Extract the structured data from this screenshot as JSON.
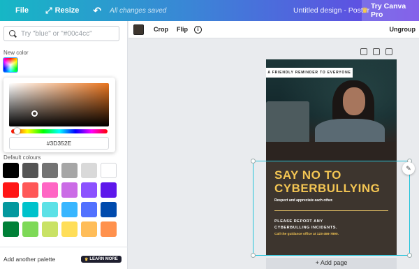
{
  "topbar": {
    "file_label": "File",
    "resize_label": "Resize",
    "undo_icon": "undo-icon",
    "saved_status": "All changes saved",
    "design_title": "Untitled design - Poster",
    "pro_label": "Try Canva Pro",
    "gradient_colors": [
      "#16b7c5",
      "#3a86d6",
      "#6a3fe6"
    ]
  },
  "color_panel": {
    "search_placeholder": "Try \"blue\" or \"#00c4cc\"",
    "new_color_label": "New color",
    "picker": {
      "hex_value": "#3D352E"
    },
    "default_colours_label": "Default colours",
    "default_swatches": [
      "#000000",
      "#545454",
      "#737373",
      "#a6a6a6",
      "#d9d9d9",
      "#ffffff",
      "#ff1616",
      "#ff5757",
      "#ff66c4",
      "#cb6ce6",
      "#8c52ff",
      "#5e17eb",
      "#03989e",
      "#00c2cb",
      "#5ce1e6",
      "#38b6ff",
      "#5271ff",
      "#004aad",
      "#008037",
      "#7ed957",
      "#c9e265",
      "#ffde59",
      "#ffbd59",
      "#ff914d"
    ],
    "add_palette_label": "Add another palette",
    "learn_more_label": "LEARN MORE"
  },
  "toolbar": {
    "current_color": "#3D352E",
    "crop_label": "Crop",
    "flip_label": "Flip",
    "info_glyph": "i",
    "ungroup_label": "Ungroup"
  },
  "poster": {
    "tagline": "A FRIENDLY REMINDER TO EVERYONE",
    "headline_line1": "SAY NO TO",
    "headline_line2": "CYBERBULLYING",
    "subhead": "Respect and appreciate each other.",
    "report_line1": "PLEASE REPORT ANY",
    "report_line2": "CYBERBULLING INCIDENTS.",
    "contact": "Call the guidance office at 123-456-7890.",
    "background_color": "#3D352E",
    "accent_color": "#f3c553"
  },
  "canvas": {
    "add_page_label": "+ Add page",
    "selection_color": "#27c4da"
  }
}
